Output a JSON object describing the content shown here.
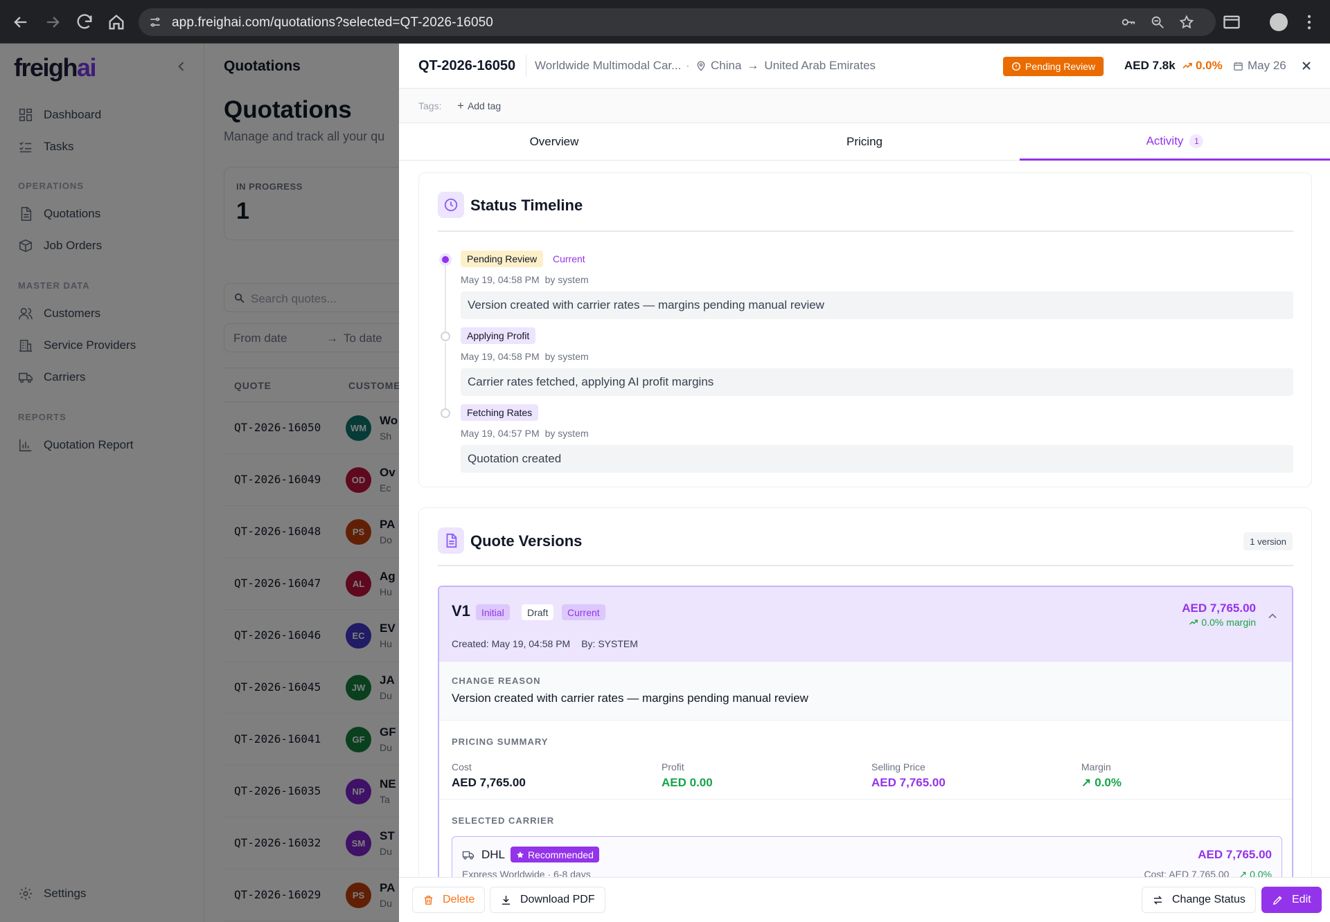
{
  "browser": {
    "url": "app.freighai.com/quotations?selected=QT-2026-16050"
  },
  "sidebar": {
    "logo_main": "freigh",
    "logo_accent": "ai",
    "items_top": [
      {
        "label": "Dashboard",
        "icon": "dashboard-icon"
      },
      {
        "label": "Tasks",
        "icon": "tasks-icon"
      }
    ],
    "section_operations": "OPERATIONS",
    "items_operations": [
      {
        "label": "Quotations",
        "icon": "document-icon"
      },
      {
        "label": "Job Orders",
        "icon": "box-icon"
      }
    ],
    "section_master": "MASTER DATA",
    "items_master": [
      {
        "label": "Customers",
        "icon": "users-icon"
      },
      {
        "label": "Service Providers",
        "icon": "building-icon"
      },
      {
        "label": "Carriers",
        "icon": "truck-icon"
      }
    ],
    "section_reports": "REPORTS",
    "items_reports": [
      {
        "label": "Quotation Report",
        "icon": "bar-chart-icon"
      }
    ],
    "settings": "Settings"
  },
  "main": {
    "header_title": "Quotations",
    "page_title": "Quotations",
    "subtitle": "Manage and track all your qu",
    "stat_label": "IN PROGRESS",
    "stat_value": "1",
    "search_placeholder": "Search quotes...",
    "date_from": "From date",
    "date_to": "To date",
    "col_quote": "QUOTE",
    "col_customer": "CUSTOME",
    "rows": [
      {
        "id": "QT-2026-16050",
        "initials": "WM",
        "color": "#0f766e",
        "name": "Wo",
        "sub": "Sh"
      },
      {
        "id": "QT-2026-16049",
        "initials": "OD",
        "color": "#be123c",
        "name": "Ov",
        "sub": "Ec"
      },
      {
        "id": "QT-2026-16048",
        "initials": "PS",
        "color": "#c2410c",
        "name": "PA",
        "sub": "Do"
      },
      {
        "id": "QT-2026-16047",
        "initials": "AL",
        "color": "#be123c",
        "name": "Ag",
        "sub": "Hu"
      },
      {
        "id": "QT-2026-16046",
        "initials": "EC",
        "color": "#4338ca",
        "name": "EV",
        "sub": "Hu"
      },
      {
        "id": "QT-2026-16045",
        "initials": "JW",
        "color": "#15803d",
        "name": "JA",
        "sub": "Du"
      },
      {
        "id": "QT-2026-16041",
        "initials": "GF",
        "color": "#15803d",
        "name": "GF",
        "sub": "Du"
      },
      {
        "id": "QT-2026-16035",
        "initials": "NP",
        "color": "#7e22ce",
        "name": "NE",
        "sub": "Ta"
      },
      {
        "id": "QT-2026-16032",
        "initials": "SM",
        "color": "#7e22ce",
        "name": "ST",
        "sub": "Du"
      },
      {
        "id": "QT-2026-16029",
        "initials": "PS",
        "color": "#c2410c",
        "name": "PA",
        "sub": "Du"
      }
    ]
  },
  "panel": {
    "quote_id": "QT-2026-16050",
    "customer": "Worldwide Multimodal Car...",
    "origin": "China",
    "destination": "United Arab Emirates",
    "status": "Pending Review",
    "amount": "AED 7.8k",
    "margin": "0.0%",
    "date": "May 26",
    "tags_label": "Tags:",
    "add_tag": "Add tag",
    "tabs": [
      {
        "label": "Overview"
      },
      {
        "label": "Pricing"
      },
      {
        "label": "Activity",
        "badge": "1"
      }
    ],
    "timeline_title": "Status Timeline",
    "timeline": [
      {
        "status": "Pending Review",
        "current": "Current",
        "time": "May 19, 04:58 PM",
        "by": "by system",
        "note": "Version created with carrier rates — margins pending manual review",
        "badge_bg": "#fdf0c8"
      },
      {
        "status": "Applying Profit",
        "current": "",
        "time": "May 19, 04:58 PM",
        "by": "by system",
        "note": "Carrier rates fetched, applying AI profit margins",
        "badge_bg": "#ede4fd"
      },
      {
        "status": "Fetching Rates",
        "current": "",
        "time": "May 19, 04:57 PM",
        "by": "by system",
        "note": "Quotation created",
        "badge_bg": "#ede4fd"
      }
    ],
    "versions_title": "Quote Versions",
    "versions_count": "1 version",
    "version": {
      "name": "V1",
      "tag_initial": "Initial",
      "tag_draft": "Draft",
      "tag_current": "Current",
      "amount": "AED 7,765.00",
      "margin": "0.0% margin",
      "created": "Created: May 19, 04:58 PM",
      "by": "By: SYSTEM",
      "change_reason_label": "CHANGE REASON",
      "change_reason": "Version created with carrier rates — margins pending manual review",
      "pricing_summary_label": "PRICING SUMMARY",
      "pricing": [
        {
          "label": "Cost",
          "value": "AED 7,765.00",
          "color": "#111827"
        },
        {
          "label": "Profit",
          "value": "AED 0.00",
          "color": "#16a34a"
        },
        {
          "label": "Selling Price",
          "value": "AED 7,765.00",
          "color": "#9333ea"
        },
        {
          "label": "Margin",
          "value": "0.0%",
          "color": "#16a34a"
        }
      ],
      "selected_carrier_label": "SELECTED CARRIER",
      "carrier": {
        "name": "DHL",
        "badge": "Recommended",
        "amount": "AED 7,765.00",
        "service": "Express Worldwide · 6-8 days",
        "cost": "Cost: AED 7,765.00",
        "margin": "0.0%"
      }
    },
    "footer": {
      "delete": "Delete",
      "download": "Download PDF",
      "change_status": "Change Status",
      "edit": "Edit"
    }
  }
}
